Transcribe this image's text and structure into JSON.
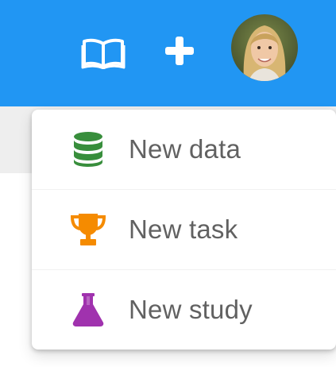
{
  "header": {
    "docs_icon": "book-open-icon",
    "add_icon": "plus-icon",
    "avatar_icon": "user-avatar",
    "background_color": "#2196F3"
  },
  "menu": {
    "items": [
      {
        "label": "New data",
        "icon": "database-icon",
        "color": "#388E3C"
      },
      {
        "label": "New task",
        "icon": "trophy-icon",
        "color": "#F58B00"
      },
      {
        "label": "New study",
        "icon": "flask-icon",
        "color": "#A032AE"
      }
    ]
  }
}
